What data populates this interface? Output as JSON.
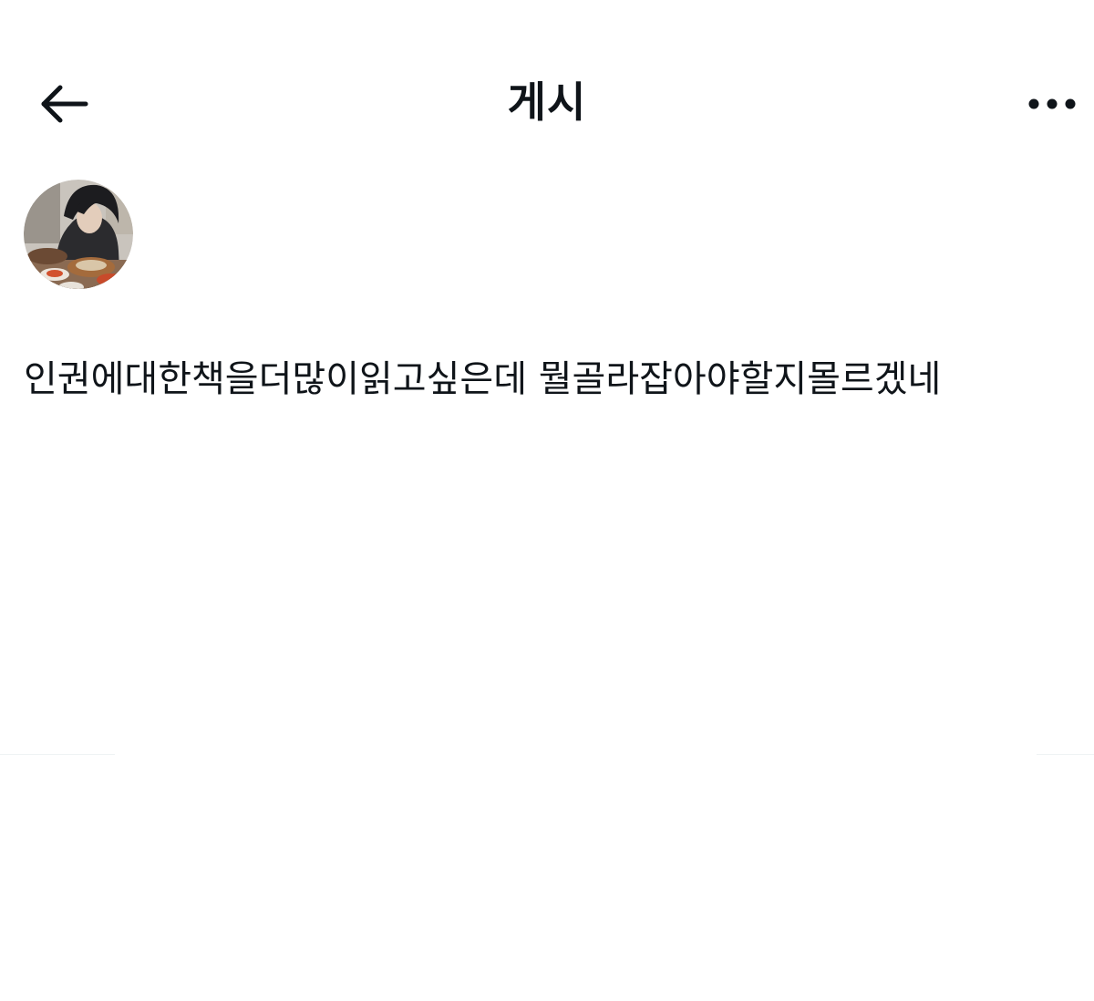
{
  "header": {
    "back_icon": "arrow-left-icon",
    "title": "게시",
    "more_icon": "more-horizontal-icon"
  },
  "post": {
    "avatar": "user-avatar-photo",
    "text": "인권에대한책을더많이읽고싶은데 뭘골라잡아야할지몰르겠네"
  },
  "colors": {
    "text": "#0f1419",
    "background": "#ffffff",
    "divider": "#eff3f4"
  }
}
